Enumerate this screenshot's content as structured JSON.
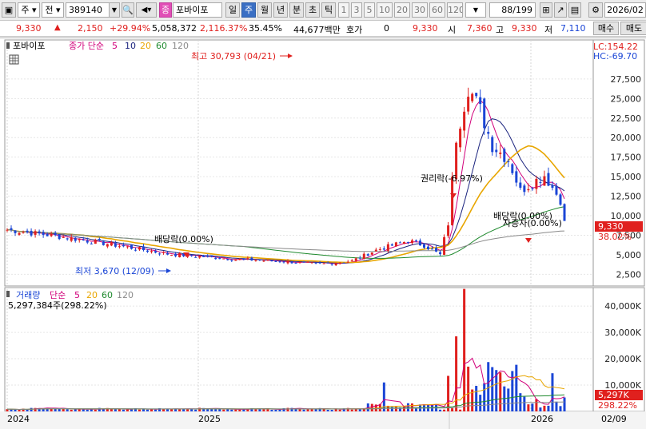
{
  "toolbar": {
    "market_label": "주",
    "type_label": "전",
    "code": "389140",
    "stock_tag": "종",
    "stock_name": "포바이포",
    "period_tabs": [
      "일",
      "주",
      "월",
      "년",
      "분",
      "초",
      "틱"
    ],
    "active_period": "주",
    "minute_options": [
      "1",
      "3",
      "5",
      "10",
      "20",
      "30",
      "60",
      "120"
    ],
    "page_counter": "88/199",
    "date_value": "2026/02"
  },
  "quote": {
    "price": "9,330",
    "change": "2,150",
    "change_pct": "+29.94%",
    "volume": "5,058,372",
    "volume_pct": "2,116.37%",
    "turnover_pct": "35.45%",
    "amount": "44,677백만",
    "hoga_label": "호가",
    "hoga_value": "0",
    "hoga_price": "9,330",
    "open_label": "시",
    "open_value": "7,360",
    "high_label": "고",
    "high_value": "9,330",
    "low_label": "저",
    "low_value": "7,110",
    "buy_button": "매수",
    "sell_button": "매도"
  },
  "price_panel": {
    "stock_title": "포바이포",
    "legend_prefix": "종가 단순",
    "ma_periods": [
      "5",
      "10",
      "20",
      "60",
      "120"
    ],
    "lc_label": "LC:154.22",
    "hc_label": "HC:-69.70",
    "high_annotation": "최고 30,793 (04/21)",
    "low_annotation": "최저 3,670 (12/09)",
    "dividend_annotation_1": "배당락(0.00%)",
    "rights_annotation": "권리락(-6.97%)",
    "dividend_annotation_2": "배당락(0.00%)",
    "capital_annotation": "자증자(0.00%)",
    "current_price_tag": "9,330",
    "current_pct_tag": "38.02%",
    "y_ticks": [
      "27,500",
      "25,000",
      "22,500",
      "20,000",
      "17,500",
      "15,000",
      "12,500",
      "10,000",
      "7,500",
      "5,000",
      "2,500"
    ]
  },
  "volume_panel": {
    "title": "거래량",
    "legend_prefix": "단순",
    "ma_periods": [
      "5",
      "20",
      "60",
      "120"
    ],
    "summary": "5,297,384주(298.22%)",
    "current_tag": "5,297K",
    "current_pct_tag": "298.22%",
    "y_ticks": [
      "40,000K",
      "30,000K",
      "20,000K",
      "10,000K"
    ]
  },
  "x_axis": {
    "labels": [
      "2024",
      "2025",
      "2026"
    ],
    "cursor_date": "02/09"
  },
  "colors": {
    "up": "#e0201e",
    "down": "#1b46d6",
    "ma5": "#d1007a",
    "ma10": "#1a237e",
    "ma20": "#e8a600",
    "ma60": "#1f8a2e",
    "ma120": "#8a8a8a"
  }
}
